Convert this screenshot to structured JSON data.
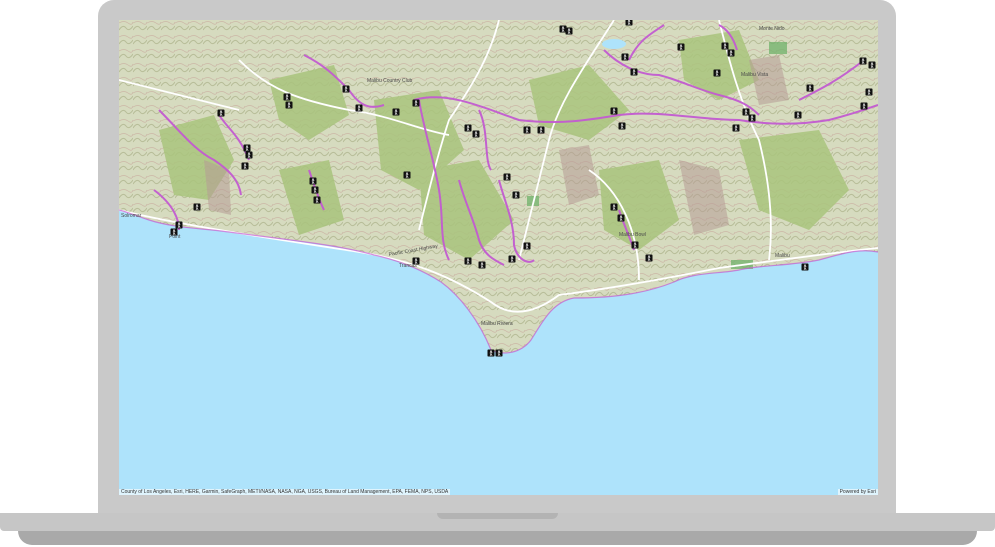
{
  "map": {
    "attribution": "County of Los Angeles, Esri, HERE, Garmin, SafeGraph, METI/NASA, NASA, NGA, USGS, Bureau of Land Management, EPA, FEMA, NPS, USDA",
    "powered_by": "Powered by Esri",
    "places": {
      "solromar": "Solromar",
      "point": "Point",
      "trancas": "Trancas",
      "malibu_riviera": "Malibu Riviera",
      "malibu_bowl": "Malibu Bowl",
      "malibu": "Malibu",
      "malibu_country_club": "Malibu Country Club",
      "pacific_coast_highway": "Pacific Coast Highway",
      "malibu_vista": "Malibu Vista",
      "monte_nido": "Monte Nido"
    },
    "colors": {
      "ocean": "#aee3fb",
      "land": "#dfe3cc",
      "vegetation": "#a9c47d",
      "trail": "#c35bd1",
      "marker": "#111111"
    },
    "icons": {
      "trailhead": "hiker-icon"
    }
  }
}
